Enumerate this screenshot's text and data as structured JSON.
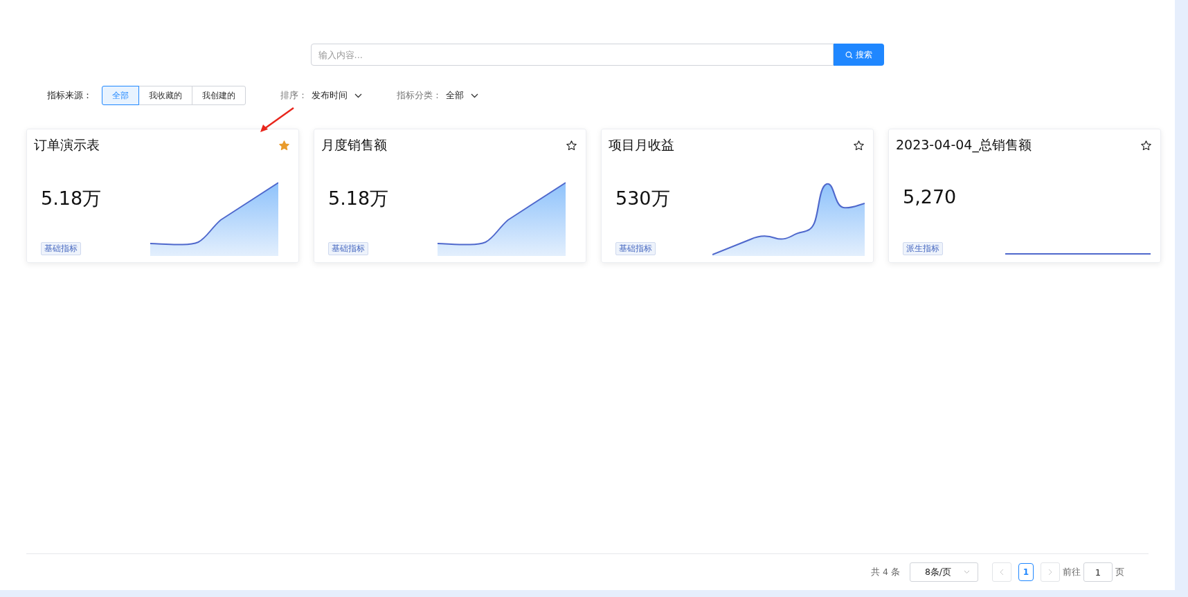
{
  "search": {
    "placeholder": "输入内容...",
    "button": "搜索"
  },
  "filters": {
    "source_label": "指标来源：",
    "sources": [
      {
        "label": "全部",
        "selected": true
      },
      {
        "label": "我收藏的",
        "selected": false
      },
      {
        "label": "我创建的",
        "selected": false
      }
    ],
    "sort_label": "排序：",
    "sort_value": "发布时间",
    "category_label": "指标分类：",
    "category_value": "全部"
  },
  "cards": [
    {
      "title": "订单演示表",
      "starred": true,
      "annotated": true,
      "value": "5.18万",
      "tag": "基础指标",
      "kind": "rising"
    },
    {
      "title": "月度销售额",
      "starred": false,
      "annotated": false,
      "value": "5.18万",
      "tag": "基础指标",
      "kind": "rising"
    },
    {
      "title": "项目月收益",
      "starred": false,
      "annotated": false,
      "value": "530万",
      "tag": "基础指标",
      "kind": "peak"
    },
    {
      "title": "2023-04-04_总销售额",
      "starred": false,
      "annotated": false,
      "value": "5,270",
      "tag": "派生指标",
      "kind": "flat"
    }
  ],
  "pagination": {
    "total": "共 4 条",
    "page_size": "8条/页",
    "pages": [
      {
        "label": "1",
        "selected": true
      }
    ],
    "prev_disabled": true,
    "next_disabled": true,
    "goto_label": "前往",
    "goto_value": "1",
    "goto_suffix": "页"
  }
}
